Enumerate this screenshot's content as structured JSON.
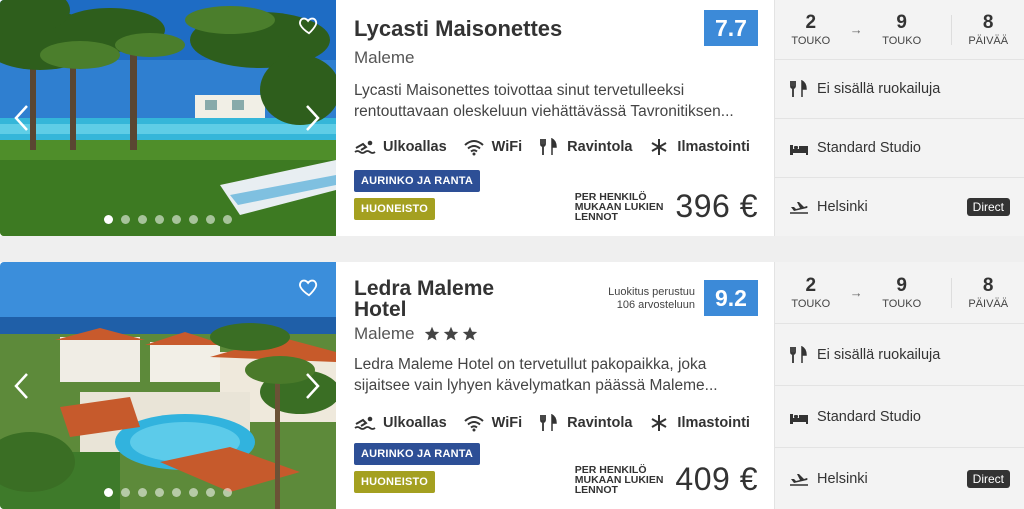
{
  "hotels": [
    {
      "name": "Lycasti Maisonettes",
      "location": "Maleme",
      "stars": 0,
      "score": "7.7",
      "score_note": [
        "",
        ""
      ],
      "description": "Lycasti Maisonettes toivottaa sinut tervetulleeksi rentouttavaan oleskeluun viehättävässä Tavronitiksen...",
      "amenities": [
        {
          "icon": "swim-icon",
          "label": "Ulkoallas"
        },
        {
          "icon": "wifi-icon",
          "label": "WiFi"
        },
        {
          "icon": "restaurant-icon",
          "label": "Ravintola"
        },
        {
          "icon": "snowflake-icon",
          "label": "Ilmastointi"
        }
      ],
      "tags": [
        "AURINKO JA RANTA",
        "HUONEISTO"
      ],
      "price_note": [
        "PER HENKILÖ",
        "MUKAAN LUKIEN",
        "LENNOT"
      ],
      "price": "396 €",
      "dates": {
        "from_day": "2",
        "from_month": "TOUKO",
        "to_day": "9",
        "to_month": "TOUKO",
        "days": "8",
        "days_label": "PÄIVÄÄ"
      },
      "meals": "Ei sisällä ruokailuja",
      "room": "Standard Studio",
      "departure": "Helsinki",
      "flight_type": "Direct",
      "image_dots": 8
    },
    {
      "name": "Ledra Maleme Hotel",
      "location": "Maleme",
      "stars": 3,
      "score": "9.2",
      "score_note": [
        "Luokitus perustuu",
        "106 arvosteluun"
      ],
      "description": "Ledra Maleme Hotel on tervetullut pakopaikka, joka sijaitsee vain lyhyen kävelymatkan päässä Maleme...",
      "amenities": [
        {
          "icon": "swim-icon",
          "label": "Ulkoallas"
        },
        {
          "icon": "wifi-icon",
          "label": "WiFi"
        },
        {
          "icon": "restaurant-icon",
          "label": "Ravintola"
        },
        {
          "icon": "snowflake-icon",
          "label": "Ilmastointi"
        }
      ],
      "tags": [
        "AURINKO JA RANTA",
        "HUONEISTO"
      ],
      "price_note": [
        "PER HENKILÖ",
        "MUKAAN LUKIEN",
        "LENNOT"
      ],
      "price": "409 €",
      "dates": {
        "from_day": "2",
        "from_month": "TOUKO",
        "to_day": "9",
        "to_month": "TOUKO",
        "days": "8",
        "days_label": "PÄIVÄÄ"
      },
      "meals": "Ei sisällä ruokailuja",
      "room": "Standard Studio",
      "departure": "Helsinki",
      "flight_type": "Direct",
      "image_dots": 8
    }
  ],
  "colors": {
    "score": "#3c8ad8",
    "tag_sun": "#2d4f96",
    "tag_apartment": "#a4a020"
  }
}
